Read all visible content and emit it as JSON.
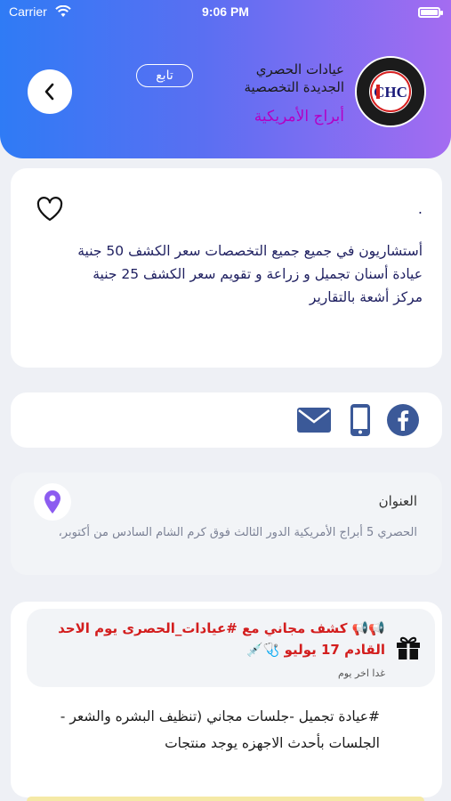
{
  "status_bar": {
    "carrier": "Carrier",
    "time": "9:06 PM"
  },
  "header": {
    "clinic_name_line1": "عيادات الحصري",
    "clinic_name_line2": "الجديدة التخصصية",
    "location_label": "أبراج الأمريكية",
    "follow_label": "تابع",
    "logo_text": "CHC",
    "colors": {
      "gradient_start": "#2f7bf5",
      "gradient_end": "#a46cf1",
      "location_color": "#b300c4"
    }
  },
  "about": {
    "dot": ".",
    "lines": [
      "أستشاريون في جميع جميع التخصصات سعر الكشف 50 جنية",
      "عيادة أسنان تجميل و زراعة و تقويم سعر الكشف 25 جنية",
      "مركز أشعة بالتقارير"
    ]
  },
  "contact": {
    "icons": [
      "facebook-icon",
      "phone-icon",
      "email-icon"
    ]
  },
  "address": {
    "title": "العنوان",
    "text": "الحصري 5 أبراج الأمريكية الدور الثالث فوق كرم الشام السادس من أكتوبر،"
  },
  "offer": {
    "headline": "📢📢 كشف مجاني مع #عيادات_الحصرى يوم الاحد القادم 17 يوليو 🩺💉",
    "when": "غدا اخر يوم",
    "post": "#عيادة تجميل -جلسات مجاني (تنظيف البشره والشعر - الجلسات بأحدث الاجهزه يوجد منتجات"
  }
}
